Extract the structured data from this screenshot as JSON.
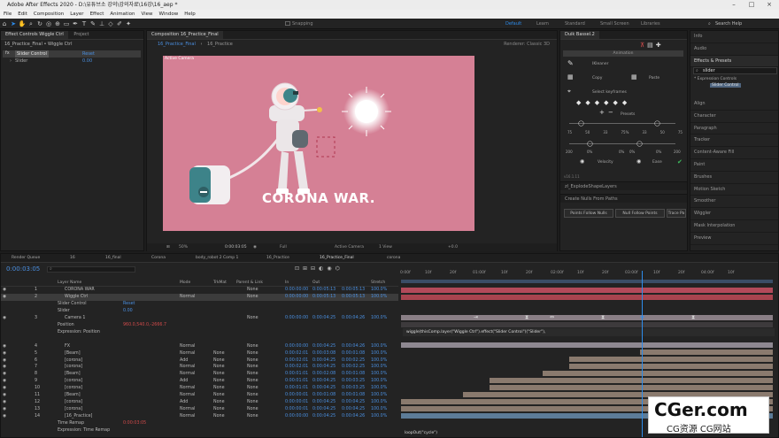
{
  "titlebar": {
    "title": "Adobe After Effects 2020 - D:\\유튜브소 강의\\강의자료\\16강\\16_aep *"
  },
  "menu": [
    "File",
    "Edit",
    "Composition",
    "Layer",
    "Effect",
    "Animation",
    "View",
    "Window",
    "Help"
  ],
  "toolbar": {
    "snapping": "Snapping",
    "workspaces": [
      "Default",
      "Learn",
      "Standard",
      "Small Screen",
      "Libraries"
    ],
    "search_placeholder": "Search Help"
  },
  "effects_panel": {
    "tab": "Effect Controls Wiggle Ctrl",
    "tab2": "Project",
    "header": "16_Practice_Final • Wiggle Ctrl",
    "effect_name": "Slider Control",
    "reset": "Reset",
    "slider_label": "Slider",
    "slider_value": "0.00"
  },
  "comp_panel": {
    "tab": "Composition 16_Practice_Final",
    "breadcrumb1": "16_Practice_Final",
    "breadcrumb2": "16_Practice",
    "active_camera_label": "Active Camera",
    "renderer": "Renderer: Classic 3D",
    "headline": "CORONA WAR.",
    "zoom": "50%",
    "timecode": "0:00:03:05",
    "quality": "Full",
    "camera": "Active Camera",
    "view": "1 View",
    "exposure": "+0.0"
  },
  "duik_panel": {
    "title": "Duik Bassel.2",
    "section": "Animation",
    "kleaner": "IKleaner",
    "copy": "Copy",
    "paste": "Paste",
    "select_keyframes": "Select keyframes",
    "presets": "Presets",
    "velocity": "Velocity",
    "ease": "Ease",
    "speed_values": [
      "75",
      "50",
      "33",
      "75%",
      "33",
      "50",
      "75"
    ],
    "influence_left": "0%",
    "influence_mid": "75%",
    "influence_right": "0%",
    "v_left": "200",
    "v_mid1": "0%",
    "v_mid2": "0%",
    "v_right": "200",
    "version": "v16.1.11",
    "explode": "zl_ExplodeShapeLayers",
    "create_nulls": "Create Nulls From Paths",
    "btn1": "Points Follow Nulls",
    "btn2": "Null Follow Points",
    "btn3": "Trace Pa"
  },
  "right_panel": {
    "items_top": [
      "Info",
      "Audio"
    ],
    "effects_presets": "Effects & Presets",
    "search_value": "slider",
    "category": "* Expression Controls",
    "match": "Slider Control",
    "items": [
      "Align",
      "Character",
      "Paragraph",
      "Tracker",
      "Content-Aware Fill",
      "Paint",
      "Brushes",
      "Motion Sketch",
      "Smoother",
      "Wiggler",
      "Mask Interpolation",
      "Preview"
    ]
  },
  "timeline": {
    "tabs": [
      "Render Queue",
      "16",
      "16_final",
      "Corona",
      "body_robot 2 Comp 1",
      "16_Practice",
      "16_Practice_Final",
      "corona"
    ],
    "timecode": "0:00:03:05",
    "columns": {
      "layer_name": "Layer Name",
      "mode": "Mode",
      "trkmat": "TrkMat",
      "parent": "Parent & Link",
      "in": "In",
      "out": "Out",
      "stretch": "Stretch"
    },
    "ruler": [
      "0:00f",
      "10f",
      "20f",
      "01:00f",
      "10f",
      "20f",
      "02:00f",
      "10f",
      "20f",
      "03:00f",
      "10f",
      "20f",
      "04:00f",
      "10f"
    ],
    "layers": [
      {
        "num": "1",
        "name": "CORONA WAR",
        "mode": "",
        "trkmat": "",
        "parent": "None",
        "in": "0:00:00:00",
        "out": "0:00:05:13",
        "dur": "0:00:05:13",
        "stretch": "100.0%"
      },
      {
        "num": "2",
        "name": "Wiggle Ctrl",
        "mode": "Normal",
        "trkmat": "",
        "parent": "None",
        "in": "0:00:00:00",
        "out": "0:00:05:13",
        "dur": "0:00:05:13",
        "stretch": "100.0%"
      },
      {
        "num": "",
        "name": "Slider Control",
        "mode": "Reset",
        "trkmat": "",
        "parent": "",
        "in": "",
        "out": "",
        "dur": "",
        "stretch": ""
      },
      {
        "num": "",
        "name": "Slider",
        "mode": "0.00",
        "trkmat": "",
        "parent": "",
        "in": "",
        "out": "",
        "dur": "",
        "stretch": ""
      },
      {
        "num": "3",
        "name": "Camera 1",
        "mode": "",
        "trkmat": "",
        "parent": "None",
        "in": "0:00:00:00",
        "out": "0:00:04:25",
        "dur": "0:00:04:26",
        "stretch": "100.0%"
      },
      {
        "num": "",
        "name": "Position",
        "mode": "960.0,540.0,-2666.7",
        "trkmat": "",
        "parent": "",
        "in": "",
        "out": "",
        "dur": "",
        "stretch": ""
      },
      {
        "num": "",
        "name": "Expression: Position",
        "mode": "",
        "trkmat": "",
        "parent": "",
        "in": "",
        "out": "",
        "dur": "",
        "stretch": ""
      },
      {
        "num": "",
        "name": "",
        "mode": "",
        "trkmat": "",
        "parent": "",
        "in": "",
        "out": "",
        "dur": "",
        "stretch": ""
      },
      {
        "num": "4",
        "name": "FX",
        "mode": "Normal",
        "trkmat": "",
        "parent": "None",
        "in": "0:00:00:00",
        "out": "0:00:04:25",
        "dur": "0:00:04:26",
        "stretch": "100.0%"
      },
      {
        "num": "5",
        "name": "[Beam]",
        "mode": "Normal",
        "trkmat": "None",
        "parent": "None",
        "in": "0:00:02:01",
        "out": "0:00:03:08",
        "dur": "0:00:01:08",
        "stretch": "100.0%"
      },
      {
        "num": "6",
        "name": "[corona]",
        "mode": "Add",
        "trkmat": "None",
        "parent": "None",
        "in": "0:00:02:01",
        "out": "0:00:04:25",
        "dur": "0:00:02:25",
        "stretch": "100.0%"
      },
      {
        "num": "7",
        "name": "[corona]",
        "mode": "Normal",
        "trkmat": "None",
        "parent": "None",
        "in": "0:00:02:01",
        "out": "0:00:04:25",
        "dur": "0:00:02:25",
        "stretch": "100.0%"
      },
      {
        "num": "8",
        "name": "[Beam]",
        "mode": "Normal",
        "trkmat": "None",
        "parent": "None",
        "in": "0:00:01:01",
        "out": "0:00:02:08",
        "dur": "0:00:01:08",
        "stretch": "100.0%"
      },
      {
        "num": "9",
        "name": "[corona]",
        "mode": "Add",
        "trkmat": "None",
        "parent": "None",
        "in": "0:00:01:01",
        "out": "0:00:04:25",
        "dur": "0:00:03:25",
        "stretch": "100.0%"
      },
      {
        "num": "10",
        "name": "[corona]",
        "mode": "Normal",
        "trkmat": "None",
        "parent": "None",
        "in": "0:00:01:01",
        "out": "0:00:04:25",
        "dur": "0:00:03:25",
        "stretch": "100.0%"
      },
      {
        "num": "11",
        "name": "[Beam]",
        "mode": "Normal",
        "trkmat": "None",
        "parent": "None",
        "in": "0:00:00:01",
        "out": "0:00:01:08",
        "dur": "0:00:01:08",
        "stretch": "100.0%"
      },
      {
        "num": "12",
        "name": "[corona]",
        "mode": "Add",
        "trkmat": "None",
        "parent": "None",
        "in": "0:00:00:01",
        "out": "0:00:04:25",
        "dur": "0:00:04:25",
        "stretch": "100.0%"
      },
      {
        "num": "13",
        "name": "[corona]",
        "mode": "Normal",
        "trkmat": "None",
        "parent": "None",
        "in": "0:00:00:01",
        "out": "0:00:04:25",
        "dur": "0:00:04:25",
        "stretch": "100.0%"
      },
      {
        "num": "14",
        "name": "[16_Practice]",
        "mode": "Normal",
        "trkmat": "None",
        "parent": "None",
        "in": "0:00:00:00",
        "out": "0:00:04:25",
        "dur": "0:00:04:26",
        "stretch": "100.0%"
      },
      {
        "num": "",
        "name": "Time Remap",
        "mode": "0:00:03:05",
        "trkmat": "",
        "parent": "",
        "in": "",
        "out": "",
        "dur": "",
        "stretch": ""
      },
      {
        "num": "",
        "name": "Expression: Time Remap",
        "mode": "",
        "trkmat": "",
        "parent": "",
        "in": "",
        "out": "",
        "dur": "",
        "stretch": ""
      }
    ],
    "expression_position": "wiggle(thisComp.layer(\"Wiggle Ctrl\").effect(\"Slider Control\")(\"Slider\"),",
    "expression_timeremap": "loopOut(\"cycle\")"
  },
  "watermark": {
    "line1": "CGer.com",
    "line2": "CG资源 CG网站"
  }
}
